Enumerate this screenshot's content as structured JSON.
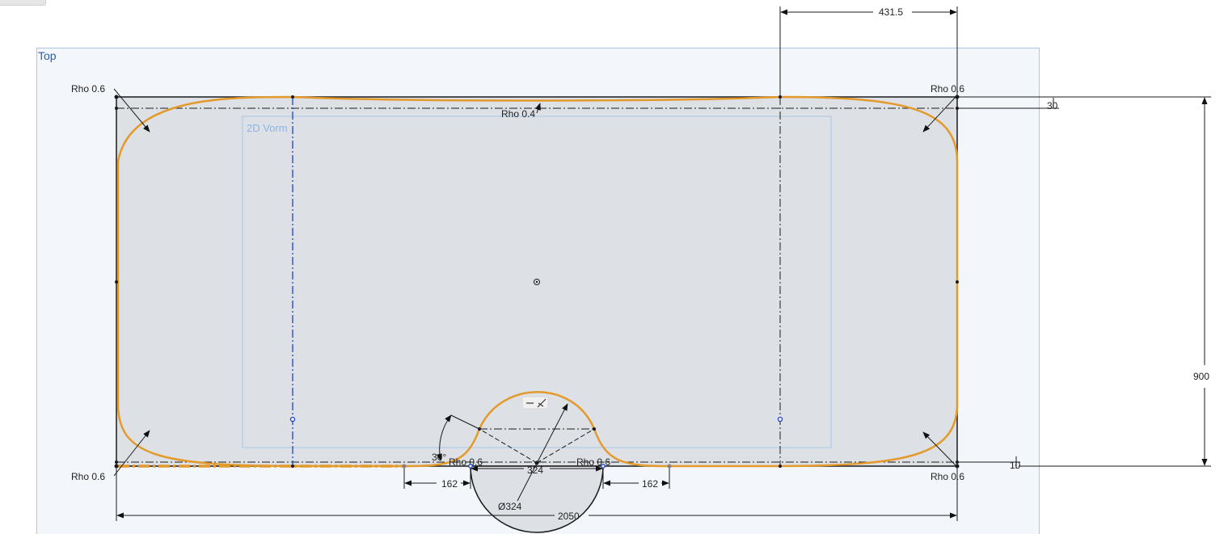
{
  "plane": {
    "label": "Top"
  },
  "region": {
    "label": "2D Vorm"
  },
  "dimensions": {
    "top_width": "431.5",
    "top_offset": "30",
    "height": "900",
    "bottom_offset": "10",
    "total_width": "2050",
    "left_segment": "162",
    "right_segment": "162",
    "notch_width": "324",
    "notch_diameter": "Ø324",
    "angle": "30°"
  },
  "rho": {
    "top_left": "Rho 0.6",
    "top_right": "Rho 0.6",
    "bottom_left": "Rho 0.6",
    "bottom_right": "Rho 0.6",
    "top_mid": "Rho 0.4",
    "notch_left": "Rho 0.6",
    "notch_right": "Rho 0.6"
  },
  "colors": {
    "profile": "#e39a2a",
    "construction_blue": "#1a3fd6",
    "sheet_fill": "#dde1e6",
    "plane_fill": "#f3f7fb",
    "plane_border": "#a9c6e8"
  }
}
